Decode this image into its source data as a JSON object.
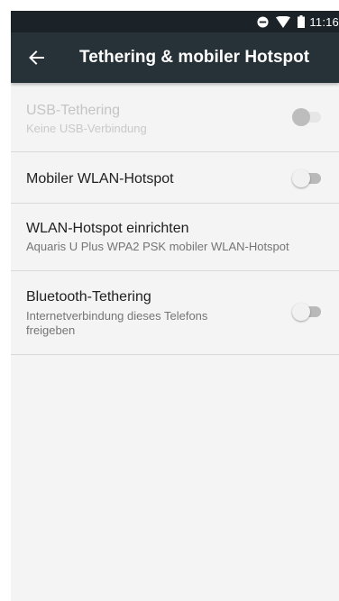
{
  "status_bar": {
    "time": "11:16",
    "icons": [
      "do-not-disturb-icon",
      "wifi-icon",
      "battery-icon"
    ]
  },
  "toolbar": {
    "back_icon": "arrow-left-icon",
    "title": "Tethering & mobiler Hotspot"
  },
  "items": [
    {
      "title": "USB-Tethering",
      "summary": "Keine USB-Verbindung",
      "enabled": false,
      "switch": "off"
    },
    {
      "title": "Mobiler WLAN-Hotspot",
      "enabled": true,
      "switch": "off"
    },
    {
      "title": "WLAN-Hotspot einrichten",
      "summary": "Aquaris U Plus WPA2 PSK mobiler WLAN-Hotspot",
      "enabled": true
    },
    {
      "title": "Bluetooth-Tethering",
      "summary": "Internetverbindung dieses Telefons freigeben",
      "enabled": true,
      "switch": "off"
    }
  ],
  "colors": {
    "status_bar": "#1b2328",
    "toolbar": "#263238",
    "background": "#f4f4f4",
    "divider": "#d9d9d9"
  }
}
